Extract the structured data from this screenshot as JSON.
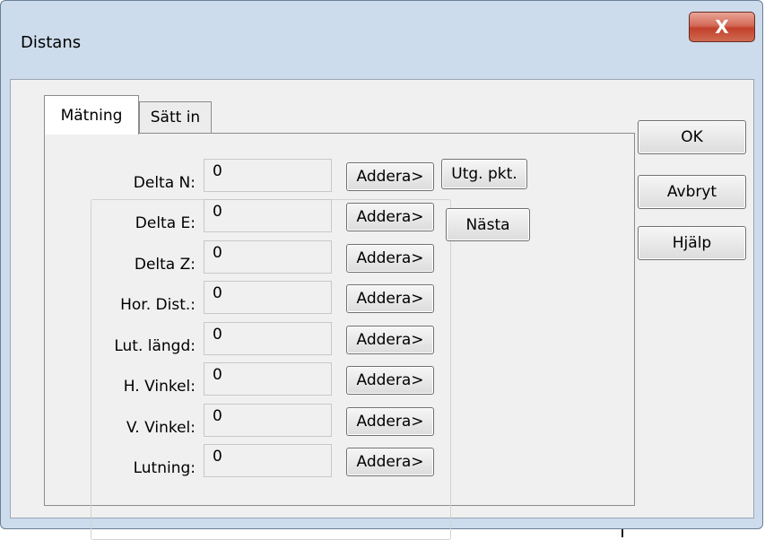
{
  "window": {
    "title": "Distans",
    "close_glyph": "X"
  },
  "tabs": [
    {
      "label": "Mätning",
      "active": true
    },
    {
      "label": "Sätt in",
      "active": false
    }
  ],
  "fields": [
    {
      "label": "Delta N:",
      "value": "0",
      "button": "Addera>"
    },
    {
      "label": "Delta E:",
      "value": "0",
      "button": "Addera>"
    },
    {
      "label": "Delta Z:",
      "value": "0",
      "button": "Addera>"
    },
    {
      "label": "Hor. Dist.:",
      "value": "0",
      "button": "Addera>"
    },
    {
      "label": "Lut. längd:",
      "value": "0",
      "button": "Addera>"
    },
    {
      "label": "H. Vinkel:",
      "value": "0",
      "button": "Addera>"
    },
    {
      "label": "V. Vinkel:",
      "value": "0",
      "button": "Addera>"
    },
    {
      "label": "Lutning:",
      "value": "0",
      "button": "Addera>"
    }
  ],
  "side_buttons": {
    "utg": "Utg. pkt.",
    "nasta": "Nästa"
  },
  "dialog_buttons": {
    "ok": "OK",
    "cancel": "Avbryt",
    "help": "Hjälp"
  },
  "colors": {
    "frame": "#ccdcec",
    "client": "#f0f0f0",
    "close": "#c2412b"
  },
  "icons": {
    "close": "close-icon"
  }
}
